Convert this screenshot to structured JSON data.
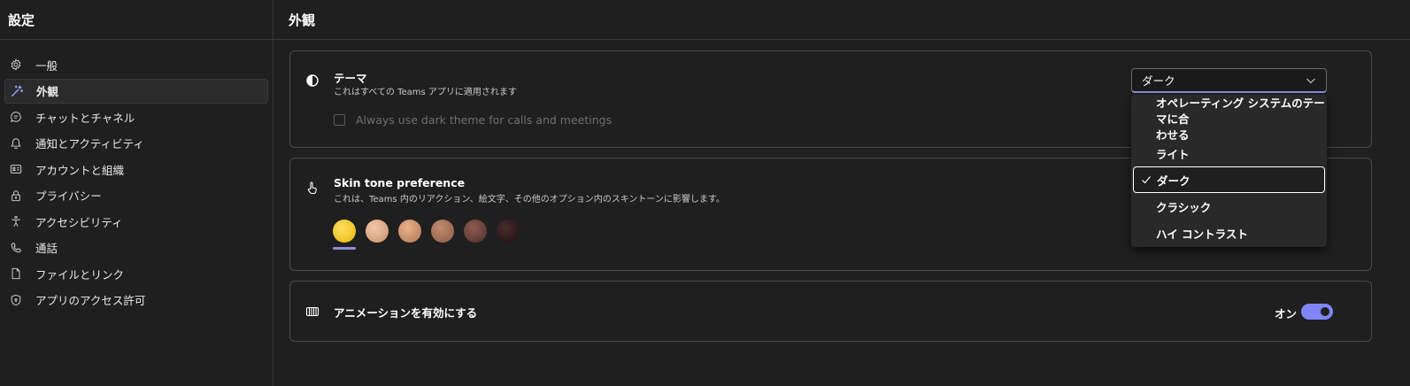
{
  "sidebar": {
    "title": "設定",
    "items": [
      {
        "label": "一般",
        "icon": "gear-icon"
      },
      {
        "label": "外観",
        "icon": "magic-wand-icon",
        "active": true
      },
      {
        "label": "チャットとチャネル",
        "icon": "chat-icon"
      },
      {
        "label": "通知とアクティビティ",
        "icon": "bell-icon"
      },
      {
        "label": "アカウントと組織",
        "icon": "id-card-icon"
      },
      {
        "label": "プライバシー",
        "icon": "lock-icon"
      },
      {
        "label": "アクセシビリティ",
        "icon": "accessibility-icon"
      },
      {
        "label": "通話",
        "icon": "phone-icon"
      },
      {
        "label": "ファイルとリンク",
        "icon": "file-icon"
      },
      {
        "label": "アプリのアクセス許可",
        "icon": "shield-icon"
      }
    ]
  },
  "main": {
    "title": "外観",
    "theme": {
      "title": "テーマ",
      "subtitle": "これはすべての Teams アプリに適用されます",
      "checkbox_label": "Always use dark theme for calls and meetings",
      "checkbox_checked": false,
      "selected": "ダーク",
      "options": [
        {
          "label": "オペレーティング システムのテーマに合",
          "label2": "わせる"
        },
        {
          "label": "ライト"
        },
        {
          "label": "ダーク",
          "selected": true
        },
        {
          "label": "クラシック"
        },
        {
          "label": "ハイ コントラスト"
        }
      ]
    },
    "skin": {
      "title": "Skin tone preference",
      "subtitle": "これは、Teams 内のリアクション、絵文字、その他のオプション内のスキントーンに影響します。",
      "tones": [
        "#f2c12e",
        "#e9b48f",
        "#d99e78",
        "#b98061",
        "#7e4f44",
        "#3a2222"
      ],
      "selected_index": 0
    },
    "animation": {
      "title": "アニメーションを有効にする",
      "toggle_label": "オン",
      "enabled": true
    }
  },
  "colors": {
    "accent": "#7f85f5",
    "background": "#1f1f1f",
    "border": "#4a4a4a"
  }
}
